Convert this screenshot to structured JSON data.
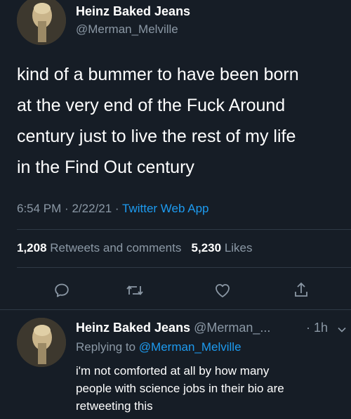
{
  "tweet": {
    "display_name": "Heinz Baked Jeans",
    "handle": "@Merman_Melville",
    "text_lines": [
      "kind of a bummer to have been born",
      "at the very end of the Fuck Around",
      "century just to live the rest of my life",
      "in the Find Out century"
    ],
    "time": "6:54 PM",
    "separator": "·",
    "date": "2/22/21",
    "source": "Twitter Web App",
    "retweets_count": "1,208",
    "retweets_label": "Retweets and comments",
    "likes_count": "5,230",
    "likes_label": "Likes"
  },
  "actions": {
    "reply_icon": "speech-bubble-icon",
    "retweet_icon": "retweet-icon",
    "like_icon": "heart-icon",
    "share_icon": "share-icon"
  },
  "reply": {
    "display_name": "Heinz Baked Jeans",
    "handle": "@Merman_...",
    "time": "· 1h",
    "replying_to_label": "Replying to",
    "replying_to_handle": "@Merman_Melville",
    "text_lines": [
      "i'm not comforted at all by how many",
      "people with science jobs in their bio are",
      "retweeting this"
    ]
  },
  "colors": {
    "background": "#161d26",
    "text": "#ffffff",
    "secondary": "#8b98a5",
    "link": "#1d9bf0",
    "divider": "#2f3a46"
  }
}
